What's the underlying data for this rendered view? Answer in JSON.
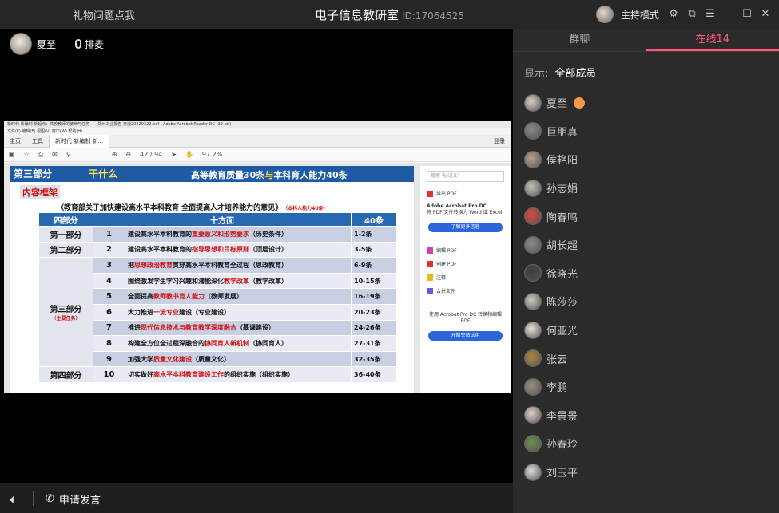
{
  "titlebar": {
    "gift": "礼物问题点我",
    "title": "电子信息教研室",
    "room_id": "ID:17064525",
    "host_mode": "主持模式"
  },
  "speaker": {
    "name": "夏至",
    "mic_label": "排麦"
  },
  "acrobat": {
    "window_title": "新时代 新编制 新起点：高校教师的使命与任务——郑州工业报告-交流20220322.pdf - Adobe Acrobat Reader DC (32-bit)",
    "menu": "文件(F)  编辑(E)  视图(V)  窗口(W)  帮助(H)",
    "tab_home": "主页",
    "tab_tools": "工具",
    "tab_doc": "新时代 新编制 新...",
    "login": "登录",
    "page": "42 / 94",
    "zoom": "97.2%",
    "panel": {
      "search": "搜索 '标记文'",
      "export": "导出 PDF",
      "promo_title": "Adobe Acrobat Pro DC",
      "promo_text": "将 PDF 文件转换为 Word 或 Excel",
      "promo_btn": "了解更多信息",
      "edit": "编辑 PDF",
      "create": "创建 PDF",
      "comment": "注释",
      "combine": "合并文件",
      "bottom_text": "使用 Acrobat Pro DC 转换和编辑 PDF",
      "bottom_btn": "开始免费试用"
    }
  },
  "slide": {
    "part": "第三部分",
    "what": "干什么",
    "head1": "高等教育质量30条",
    "head_and": "与",
    "head2": "本科育人能力40条",
    "kuangjia": "内容框架",
    "subtitle": "《教育部关于加快建设高水平本科教育 全面提高人才培养能力的意见》",
    "subtitle_tag": "（本科人能力40条）",
    "cols": [
      "四部分",
      "十方面",
      "40条"
    ],
    "rows": [
      {
        "part": "第一部分",
        "no": "1",
        "pre": "建设高水平本科教育的",
        "red": "重要意义和形势要求",
        "post": "（历史条件）",
        "range": "1-2条"
      },
      {
        "part": "第二部分",
        "no": "2",
        "pre": "建设高水平本科教育的",
        "red": "指导思想和目标原则",
        "post": "（顶层设计）",
        "range": "3-5条"
      },
      {
        "part": "",
        "no": "3",
        "pre": "把",
        "red": "思想政治教育",
        "post": "贯穿高水平本科教育全过程（思政教育）",
        "range": "6-9条"
      },
      {
        "part": "",
        "no": "4",
        "pre": "围绕激发学生学习兴趣和潜能深化",
        "red": "教学改革",
        "post": "（教学改革）",
        "range": "10-15条"
      },
      {
        "part": "",
        "no": "5",
        "pre": "全面提高",
        "red": "教师教书育人能力",
        "post": "（教师发展）",
        "range": "16-19条"
      },
      {
        "part": "",
        "no": "6",
        "pre": "大力推进",
        "red": "一流专业",
        "post": "建设（专业建设）",
        "range": "20-23条"
      },
      {
        "part": "",
        "no": "7",
        "pre": "推进",
        "red": "现代信息技术与教育教学深度融合",
        "post": "（慕课建设）",
        "range": "24-26条"
      },
      {
        "part": "",
        "no": "8",
        "pre": "构建全方位全过程深融合的",
        "red": "协同育人新机制",
        "post": "（协同育人）",
        "range": "27-31条"
      },
      {
        "part": "",
        "no": "9",
        "pre": "加强大学",
        "red": "质量文化建设",
        "post": "（质量文化）",
        "range": "32-35条"
      },
      {
        "part": "第四部分",
        "no": "10",
        "pre": "切实做好",
        "red": "高水平本科教育建设工作",
        "post": "的组织实施（组织实施）",
        "range": "36-40条"
      }
    ],
    "part3": "第三部分",
    "part3_sub": "（主要任务）"
  },
  "bottom": {
    "request": "申请发言"
  },
  "side": {
    "tab_chat": "群聊",
    "tab_online": "在线14",
    "show_label": "显示:",
    "show_value": "全部成员",
    "members": [
      "夏至",
      "巨朋真",
      "侯艳阳",
      "孙志娟",
      "陶春鸣",
      "胡长超",
      "徐晓光",
      "陈莎莎",
      "何亚光",
      "张云",
      "李鹏",
      "李景景",
      "孙春玲",
      "刘玉平"
    ]
  }
}
